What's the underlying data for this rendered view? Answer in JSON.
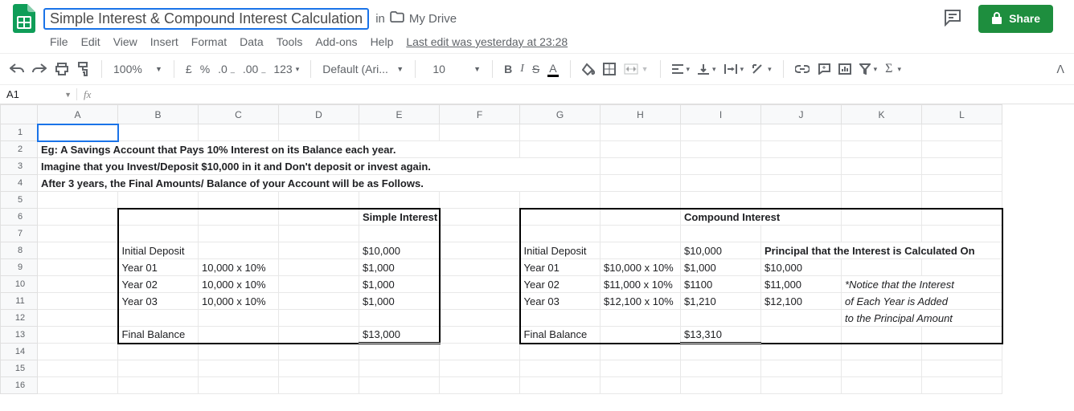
{
  "header": {
    "doc_title": "Simple Interest & Compound Interest Calculation",
    "location_prefix": "in",
    "folder": "My Drive",
    "share_label": "Share",
    "last_edit": "Last edit was yesterday at 23:28"
  },
  "menus": [
    "File",
    "Edit",
    "View",
    "Insert",
    "Format",
    "Data",
    "Tools",
    "Add-ons",
    "Help"
  ],
  "toolbar": {
    "zoom": "100%",
    "currency": "£",
    "percent": "%",
    "dec_dec": ".0",
    "dec_inc": ".00",
    "num_fmt": "123",
    "font": "Default (Ari...",
    "font_size": "10"
  },
  "name_box": "A1",
  "columns": [
    "A",
    "B",
    "C",
    "D",
    "E",
    "F",
    "G",
    "H",
    "I",
    "J",
    "K",
    "L"
  ],
  "cells": {
    "r2": {
      "A": "Eg: A Savings Account that Pays 10% Interest on its Balance each year."
    },
    "r3": {
      "A": "Imagine that you Invest/Deposit $10,000 in it and Don't deposit or invest again."
    },
    "r4": {
      "A": "After 3 years, the Final Amounts/ Balance of your Account will be as Follows."
    },
    "r6": {
      "E": "Simple Interest",
      "I": "Compound Interest"
    },
    "r8": {
      "B": "Initial Deposit",
      "E": "$10,000",
      "G": "Initial Deposit",
      "I": "$10,000",
      "J": "Principal that the Interest is Calculated On"
    },
    "r9": {
      "B": "Year 01",
      "C": "10,000 x 10%",
      "E": "$1,000",
      "G": "Year 01",
      "H": "$10,000 x 10%",
      "I": "$1,000",
      "J": "$10,000"
    },
    "r10": {
      "B": "Year 02",
      "C": "10,000 x 10%",
      "E": "$1,000",
      "G": "Year 02",
      "H": "$11,000 x 10%",
      "I": "$1100",
      "J": "$11,000",
      "K": "*Notice that the Interest"
    },
    "r11": {
      "B": "Year 03",
      "C": "10,000 x 10%",
      "E": "$1,000",
      "G": "Year 03",
      "H": "$12,100 x 10%",
      "I": "$1,210",
      "J": "$12,100",
      "K": "of Each Year is Added"
    },
    "r12": {
      "K": "to the Principal Amount"
    },
    "r13": {
      "B": "Final Balance",
      "E": "$13,000",
      "G": "Final Balance",
      "I": "$13,310"
    }
  }
}
